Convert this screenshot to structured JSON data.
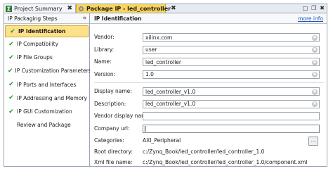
{
  "tabs": [
    {
      "label": "Project Summary",
      "icon": "sigma-icon",
      "close": "✖"
    },
    {
      "label": "Package IP - led_controller",
      "icon": "gear-icon",
      "close": "✖"
    }
  ],
  "window_controls": {
    "restore": "□",
    "maximize": "❐",
    "close": "✖"
  },
  "left_panel": {
    "title": "IP Packaging Steps",
    "collapse_icon": "«",
    "check_glyph": "✔",
    "steps": [
      {
        "label": "IP Identification",
        "checked": true,
        "active": true
      },
      {
        "label": "IP Compatibility",
        "checked": true
      },
      {
        "label": "IP File Groups",
        "checked": true
      },
      {
        "label": "IP Customization Parameters",
        "checked": true
      },
      {
        "label": "IP Ports and Interfaces",
        "checked": true
      },
      {
        "label": "IP Addressing and Memory",
        "checked": true
      },
      {
        "label": "IP GUI Customization",
        "checked": true
      },
      {
        "label": "Review and Package",
        "checked": false
      }
    ]
  },
  "main": {
    "title": "IP Identification",
    "more_info": "more info",
    "clear_glyph": "✖",
    "ellipsis": "...",
    "fields": {
      "vendor": {
        "label": "Vendor:",
        "value": "xilinx.com"
      },
      "library": {
        "label": "Library:",
        "value": "user"
      },
      "name": {
        "label": "Name:",
        "value": "led_controller"
      },
      "version": {
        "label": "Version:",
        "value": "1.0"
      },
      "display_name": {
        "label": "Display name:",
        "value": "led_controller_v1.0"
      },
      "description": {
        "label": "Description:",
        "value": "led_controller_v1.0"
      },
      "vendor_display_name": {
        "label": "Vendor display name:",
        "value": ""
      },
      "company_url": {
        "label": "Company url:",
        "value": ""
      }
    },
    "categories": {
      "label": "Categories:",
      "value": "AXI_Peripheral"
    },
    "root_directory": {
      "label": "Root directory:",
      "value": "c:/Zynq_Book/led_controller/led_controller_1.0"
    },
    "xml_file_name": {
      "label": "Xml file name:",
      "value": "c:/Zynq_Book/led_controller/led_controller_1.0/component.xml"
    }
  }
}
